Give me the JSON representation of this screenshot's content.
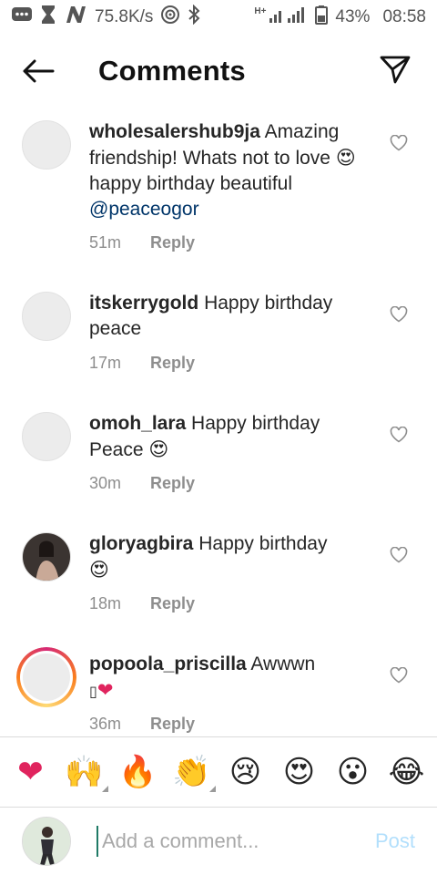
{
  "status_bar": {
    "speed": "75.8K/s",
    "network": "H+",
    "battery": "43%",
    "time": "08:58"
  },
  "header": {
    "title": "Comments"
  },
  "comments": [
    {
      "username": "wholesalershub9ja",
      "text_parts": [
        "Amazing friendship! Whats not to love ",
        "😍",
        " happy birthday beautiful "
      ],
      "mention": "@peaceogor",
      "time": "51m",
      "reply": "Reply"
    },
    {
      "username": "itskerrygold",
      "text": "Happy birthday peace",
      "time": "17m",
      "reply": "Reply"
    },
    {
      "username": "omoh_lara",
      "text": "Happy birthday Peace ",
      "emoji": "😍",
      "time": "30m",
      "reply": "Reply"
    },
    {
      "username": "gloryagbira",
      "text": "Happy birthday",
      "emoji": "😍",
      "time": "18m",
      "reply": "Reply"
    },
    {
      "username": "popoola_priscilla",
      "text": "Awwwn",
      "emoji_missing": "▯",
      "emoji": "❤",
      "time": "36m",
      "reply": "Reply"
    }
  ],
  "quick_emojis": [
    "❤",
    "🙌",
    "🔥",
    "👏",
    "😢",
    "😍",
    "😮",
    "😂"
  ],
  "composer": {
    "placeholder": "Add a comment...",
    "post_label": "Post"
  },
  "colors": {
    "mention": "#003569",
    "post_disabled": "#b2dffc",
    "heart_emoji": "#e0245e"
  }
}
